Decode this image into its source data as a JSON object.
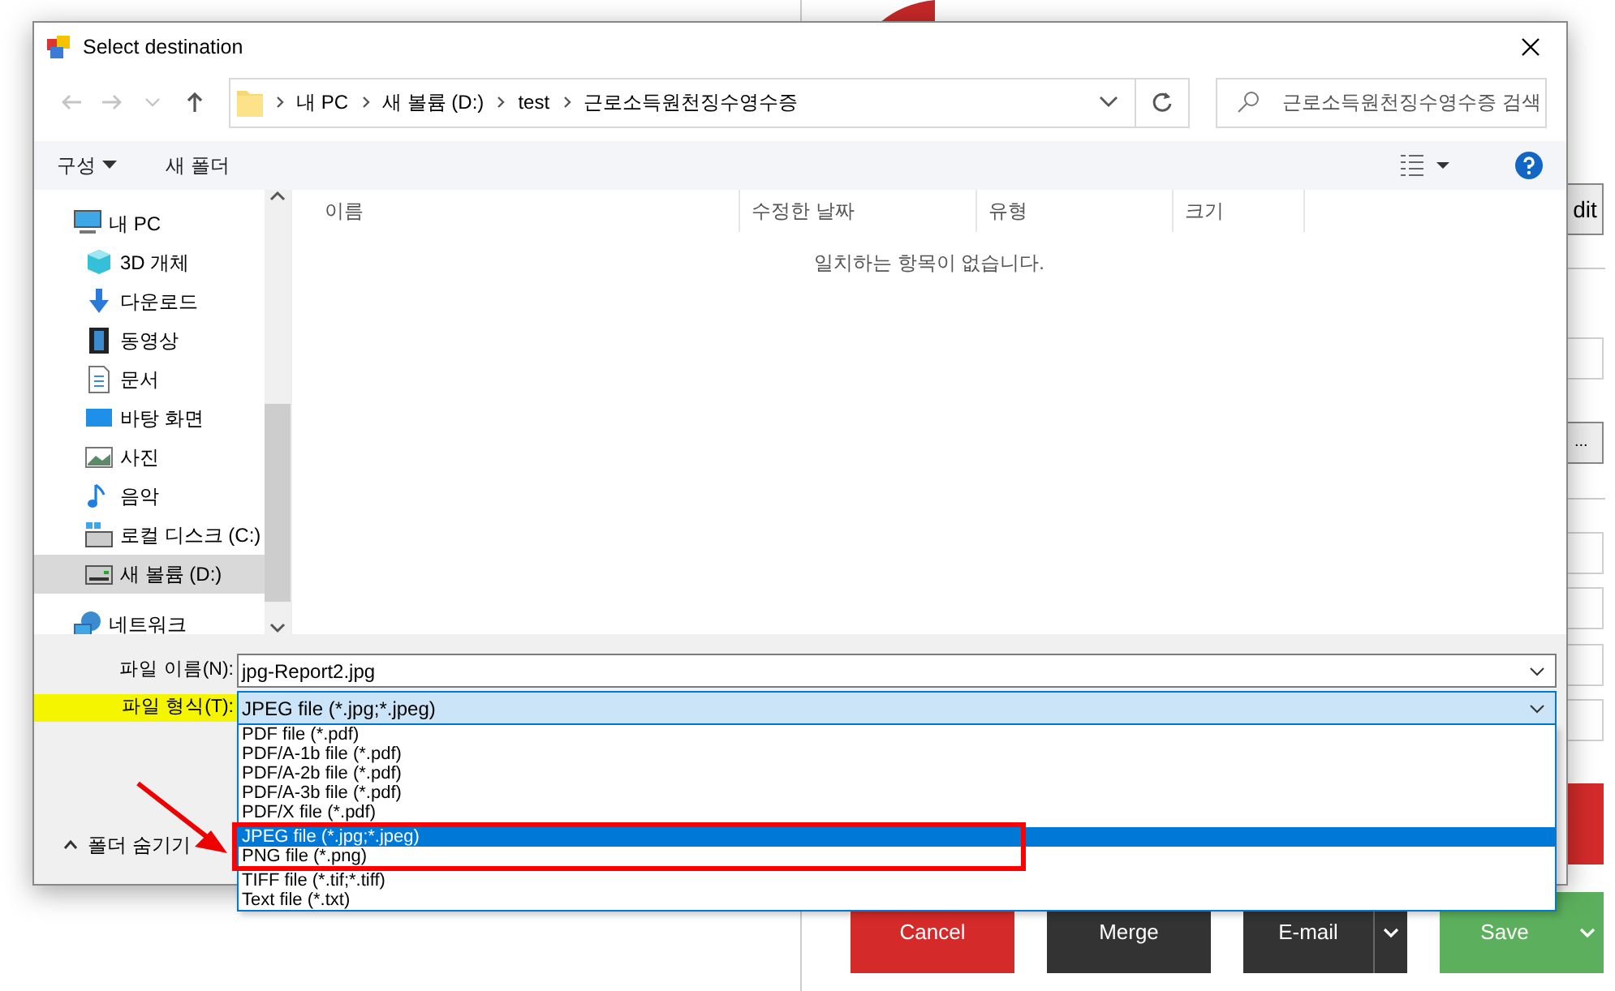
{
  "background_app": {
    "edit_button": "dit",
    "browse_button": "...",
    "buttons": [
      {
        "label": "Cancel",
        "kind": "cancel",
        "split": false
      },
      {
        "label": "Merge",
        "kind": "dark",
        "split": false
      },
      {
        "label": "E-mail",
        "kind": "dark",
        "split": true
      },
      {
        "label": "Save",
        "kind": "save",
        "split": true
      }
    ]
  },
  "dialog": {
    "title": "Select destination",
    "nav": [
      {
        "kind": "back",
        "disabled": true
      },
      {
        "kind": "forward",
        "disabled": true
      },
      {
        "kind": "recent",
        "disabled": true
      },
      {
        "kind": "up",
        "disabled": false
      }
    ],
    "breadcrumb": [
      "내 PC",
      "새 볼륨 (D:)",
      "test",
      "근로소득원천징수영수증"
    ],
    "search": {
      "placeholder": "근로소득원천징수영수증 검색"
    },
    "toolbar": {
      "organize": "구성",
      "new_folder": "새 폴더"
    },
    "sidebar": {
      "items": [
        {
          "label": "내 PC",
          "kind": "pc",
          "selected": false,
          "children": [
            {
              "label": "3D 개체",
              "kind": "cube",
              "selected": false
            },
            {
              "label": "다운로드",
              "kind": "download",
              "selected": false
            },
            {
              "label": "동영상",
              "kind": "video",
              "selected": false
            },
            {
              "label": "문서",
              "kind": "document",
              "selected": false
            },
            {
              "label": "바탕 화면",
              "kind": "desktop",
              "selected": false
            },
            {
              "label": "사진",
              "kind": "photo",
              "selected": false
            },
            {
              "label": "음악",
              "kind": "music",
              "selected": false
            },
            {
              "label": "로컬 디스크 (C:)",
              "kind": "drive-c",
              "selected": false
            },
            {
              "label": "새 볼륨 (D:)",
              "kind": "drive",
              "selected": true
            }
          ]
        },
        {
          "label": "네트워크",
          "kind": "network",
          "selected": false
        }
      ]
    },
    "columns": [
      "이름",
      "수정한 날짜",
      "유형",
      "크기"
    ],
    "empty_message": "일치하는 항목이 없습니다.",
    "file_name": {
      "label": "파일 이름(N):",
      "value": "jpg-Report2.jpg"
    },
    "file_type": {
      "label": "파일 형식(T):",
      "value": "JPEG file (*.jpg;*.jpeg)",
      "highlighted": true
    },
    "options": [
      {
        "label": "PDF file (*.pdf)",
        "selected": false
      },
      {
        "label": "PDF/A-1b file (*.pdf)",
        "selected": false
      },
      {
        "label": "PDF/A-2b file (*.pdf)",
        "selected": false
      },
      {
        "label": "PDF/A-3b file (*.pdf)",
        "selected": false
      },
      {
        "label": "PDF/X file (*.pdf)",
        "selected": false
      },
      {
        "label": "JPEG file (*.jpg;*.jpeg)",
        "selected": true
      },
      {
        "label": "PNG file (*.png)",
        "selected": false
      },
      {
        "label": "TIFF file (*.tif;*.tiff)",
        "selected": false
      },
      {
        "label": "Text file (*.txt)",
        "selected": false
      }
    ],
    "hide_folders": "폴더 숨기기"
  }
}
